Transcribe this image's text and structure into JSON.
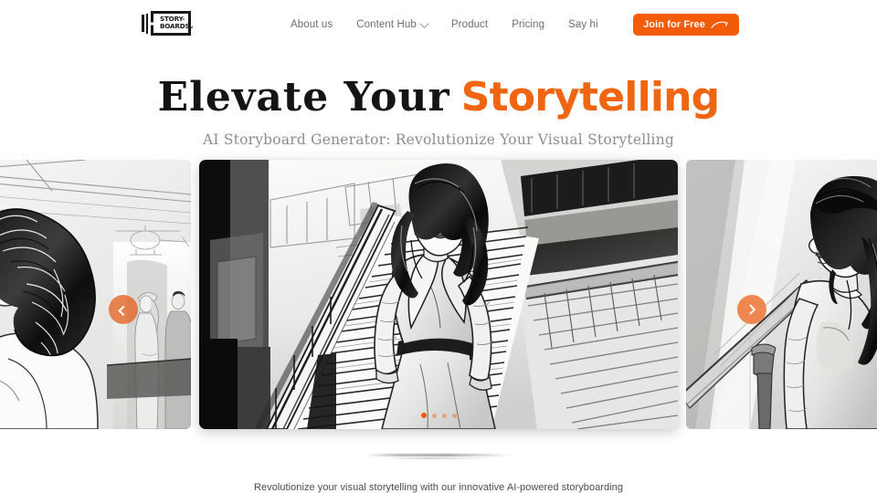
{
  "header": {
    "logo": {
      "name": "storyboards-logo",
      "line1": "STORY-",
      "line2": "BOARDS",
      "suffix": "ai"
    },
    "nav": [
      {
        "label": "About us",
        "has_dropdown": false
      },
      {
        "label": "Content Hub",
        "has_dropdown": true
      },
      {
        "label": "Product",
        "has_dropdown": false
      },
      {
        "label": "Pricing",
        "has_dropdown": false
      },
      {
        "label": "Say hi",
        "has_dropdown": false
      }
    ],
    "cta": {
      "label": "Join for Free",
      "icon": "swoosh-arrow-icon",
      "bg": "#f45b07",
      "color": "#ffffff"
    }
  },
  "hero": {
    "headline_dark": "Elevate Your",
    "headline_accent": "Storytelling",
    "accent_color": "#ef6511",
    "subtitle": "AI Storyboard Generator: Revolutionize Your Visual Storytelling"
  },
  "carousel": {
    "prev_icon": "chevron-left-icon",
    "next_icon": "chevron-right-icon",
    "active_index": 0,
    "dot_count": 4,
    "slides": [
      {
        "position": "left",
        "alt": "Storyboard sketch: back view of a woman with an updo hairstyle in a terminal with a helicopter and waiting passengers"
      },
      {
        "position": "center",
        "alt": "Storyboard sketch: woman in a belted trench coat descending a grand staircase"
      },
      {
        "position": "right",
        "alt": "Storyboard sketch: woman with fringe bangs glancing over her shoulder beside a stair banister"
      }
    ]
  },
  "footer": {
    "tagline": "Revolutionize your visual storytelling with our innovative AI-powered storyboarding"
  }
}
